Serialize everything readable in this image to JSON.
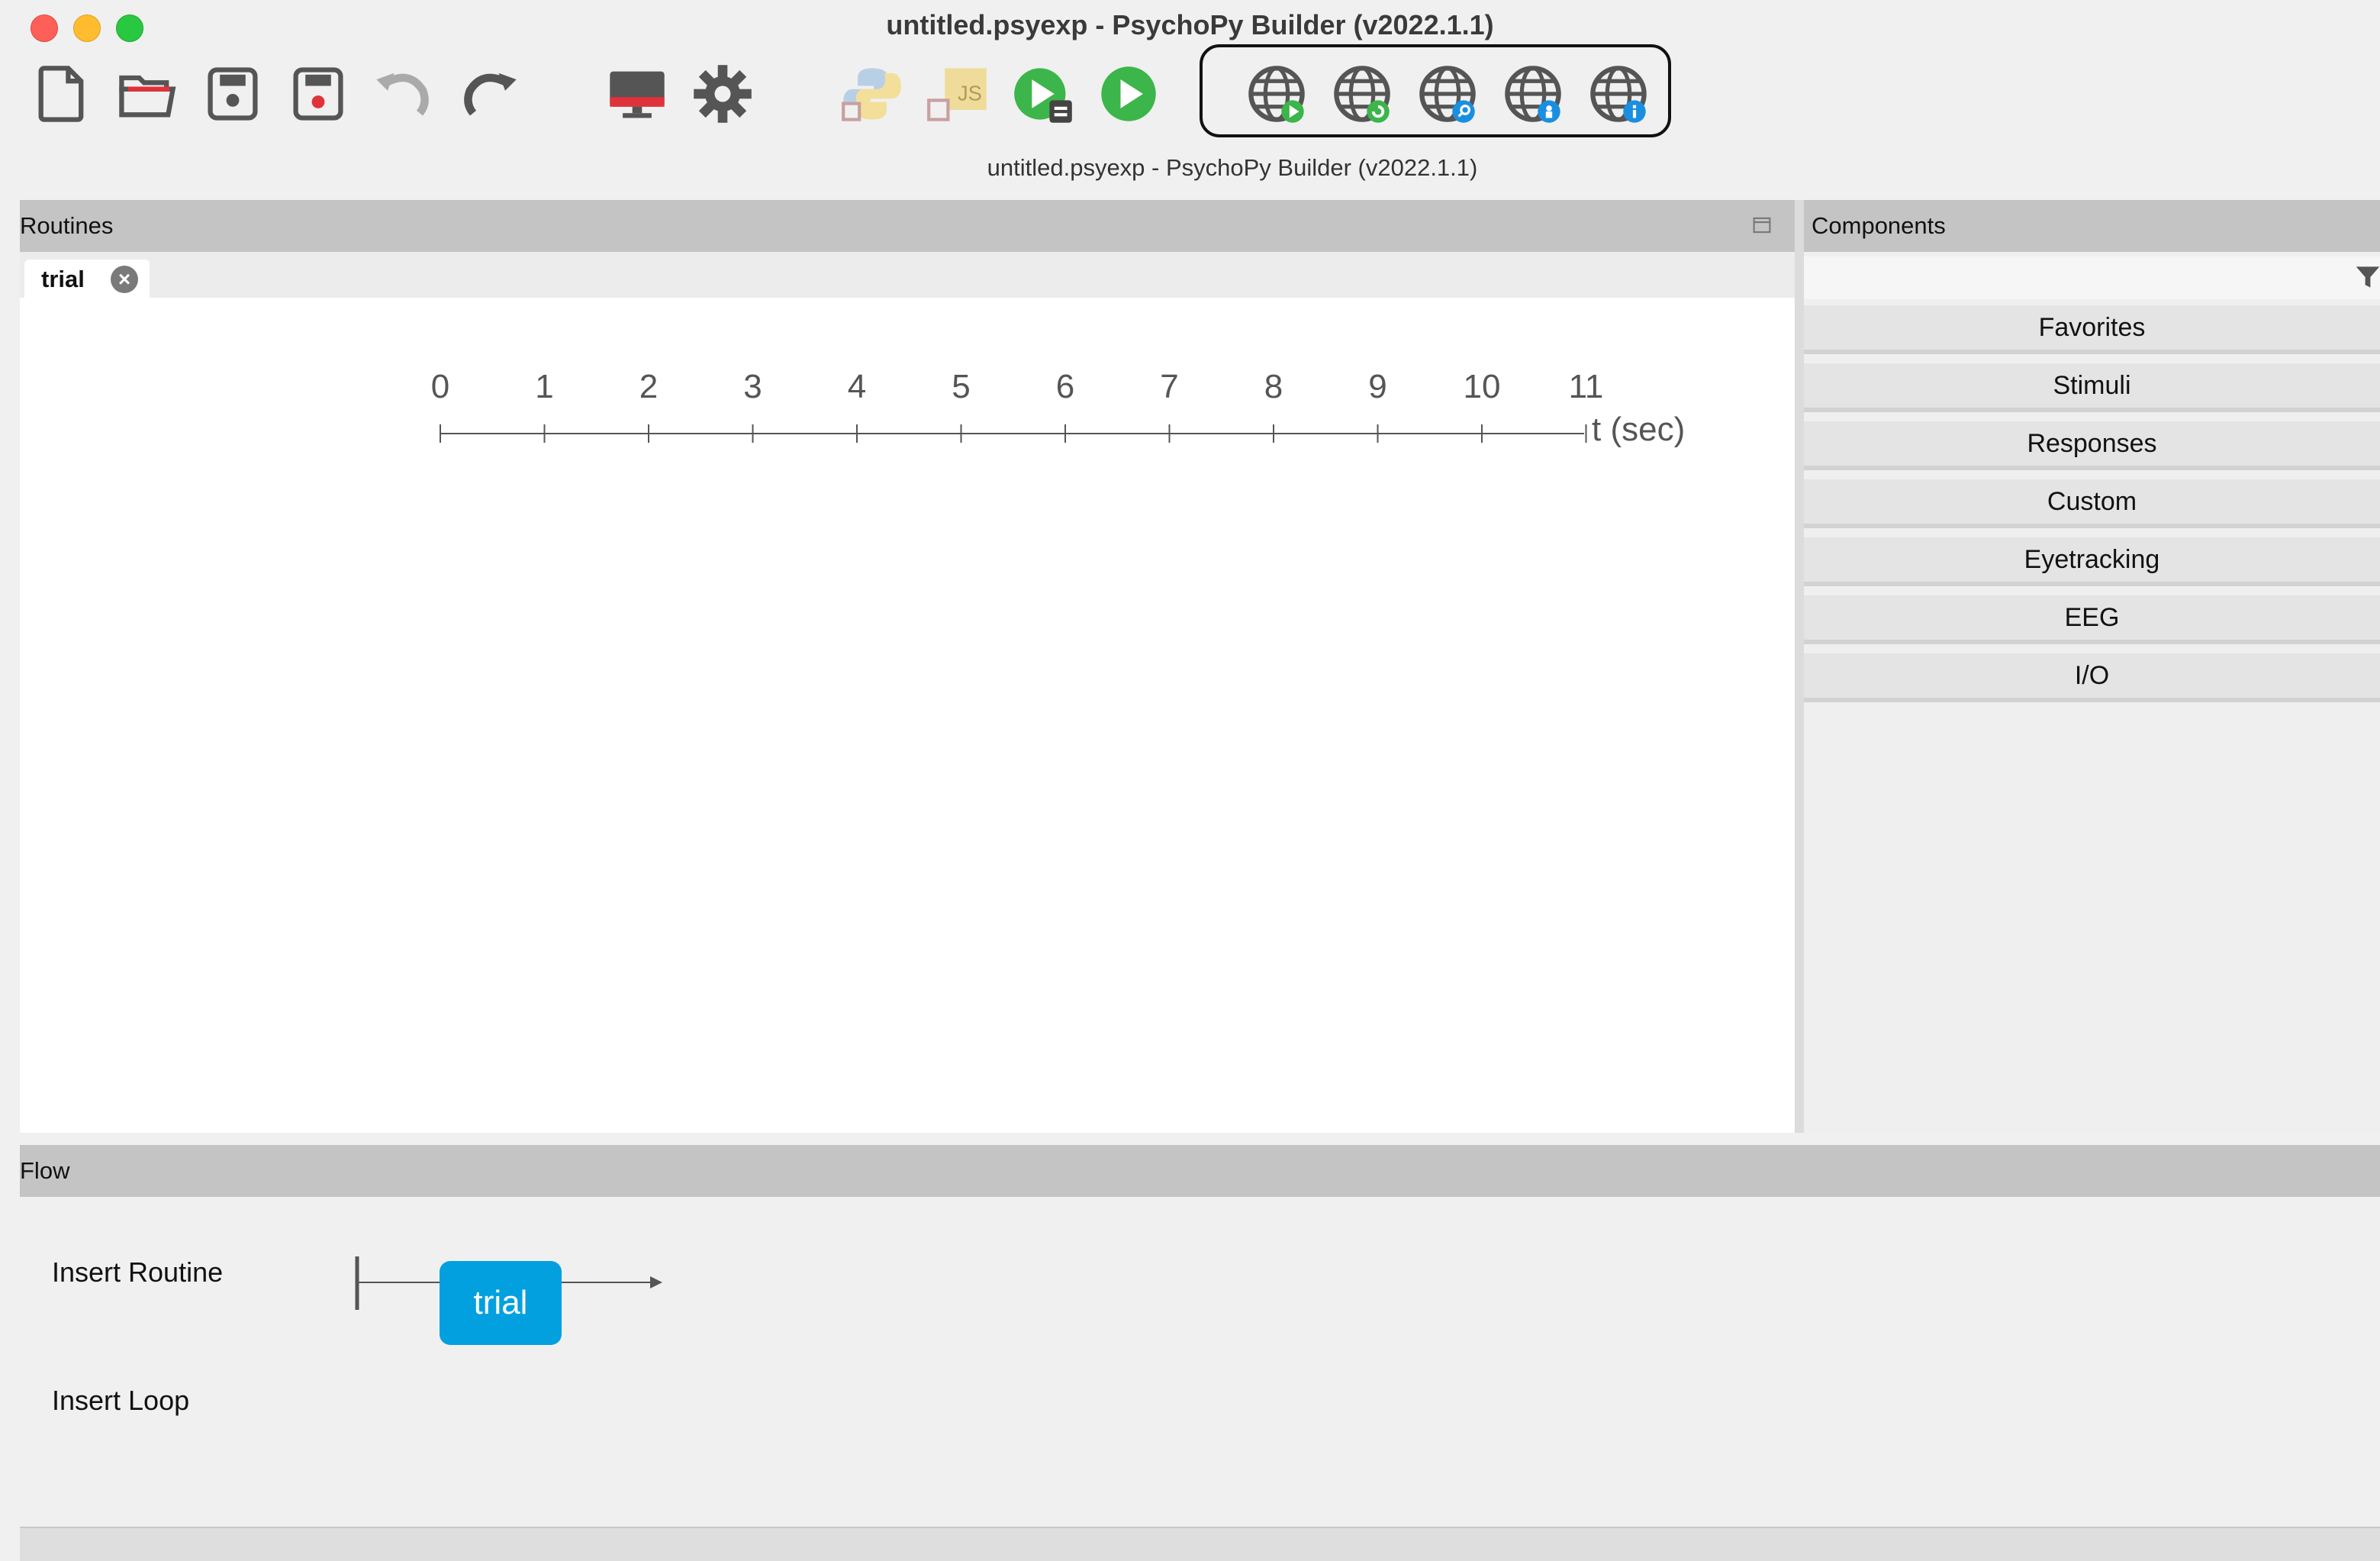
{
  "window": {
    "title": "untitled.psyexp - PsychoPy Builder (v2022.1.1)",
    "subtitle": "untitled.psyexp - PsychoPy Builder (v2022.1.1)"
  },
  "toolbar": {
    "file_icons": [
      "new-file-icon",
      "open-folder-icon",
      "save-icon",
      "save-as-icon",
      "undo-icon",
      "redo-icon"
    ],
    "settings_icons": [
      "monitor-icon",
      "gear-icon"
    ],
    "compile_icons": [
      "compile-python-icon",
      "compile-js-icon",
      "runner-icon",
      "run-icon"
    ],
    "online_icons": [
      "run-online-icon",
      "sync-online-icon",
      "search-online-icon",
      "user-online-icon",
      "project-info-icon"
    ],
    "colors": {
      "green": "#3cb54a",
      "red": "#e0323a",
      "blue": "#1a8fe0",
      "gray": "#555555"
    }
  },
  "routines": {
    "panel_label": "Routines",
    "tab_label": "trial",
    "timeline": {
      "ticks": [
        "0",
        "1",
        "2",
        "3",
        "4",
        "5",
        "6",
        "7",
        "8",
        "9",
        "10",
        "11"
      ],
      "unit_label": "t (sec)"
    }
  },
  "components": {
    "panel_label": "Components",
    "categories": [
      "Favorites",
      "Stimuli",
      "Responses",
      "Custom",
      "Eyetracking",
      "EEG",
      "I/O"
    ]
  },
  "flow": {
    "panel_label": "Flow",
    "insert_routine": "Insert Routine",
    "insert_loop": "Insert Loop",
    "routine_label": "trial",
    "routine_color": "#03a0e0"
  }
}
